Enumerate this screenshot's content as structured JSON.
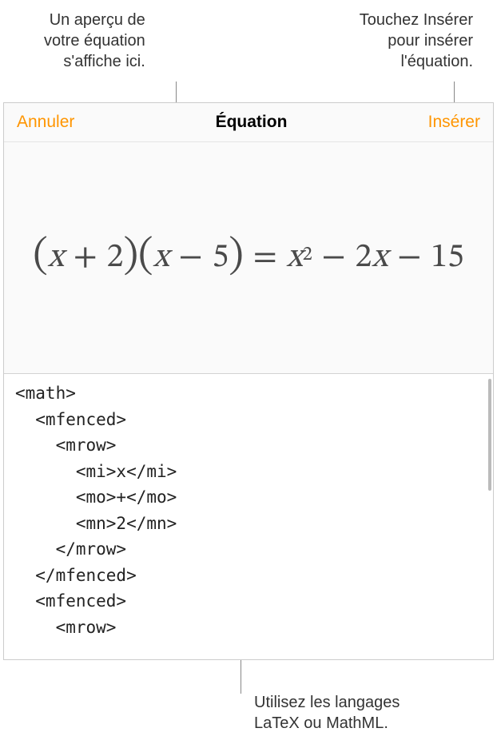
{
  "annotations": {
    "top_left": "Un aperçu de\nvotre équation\ns'affiche ici.",
    "top_right": "Touchez Insérer\npour insérer\nl'équation.",
    "bottom": "Utilisez les langages\nLaTeX ou MathML."
  },
  "header": {
    "cancel_label": "Annuler",
    "title": "Équation",
    "insert_label": "Insérer"
  },
  "equation_preview": {
    "display_latex": "(x + 2)(x - 5) = x^2 - 2x - 15",
    "parts": {
      "lpar1": "(",
      "x1": "x",
      "plus": "+",
      "n2": "2",
      "rpar1": ")",
      "lpar2": "(",
      "x2": "x",
      "minus1": "−",
      "n5": "5",
      "rpar2": ")",
      "eq": "=",
      "x3": "x",
      "sup2": "2",
      "minus2": "−",
      "coef2": "2",
      "x4": "x",
      "minus3": "−",
      "n15": "15"
    }
  },
  "code": {
    "content": "<math>\n  <mfenced>\n    <mrow>\n      <mi>x</mi>\n      <mo>+</mo>\n      <mn>2</mn>\n    </mrow>\n  </mfenced>\n  <mfenced>\n    <mrow>"
  },
  "colors": {
    "accent": "#ff9500",
    "text": "#333333",
    "panel_bg": "#fafafa",
    "border": "#d3d3d3"
  }
}
